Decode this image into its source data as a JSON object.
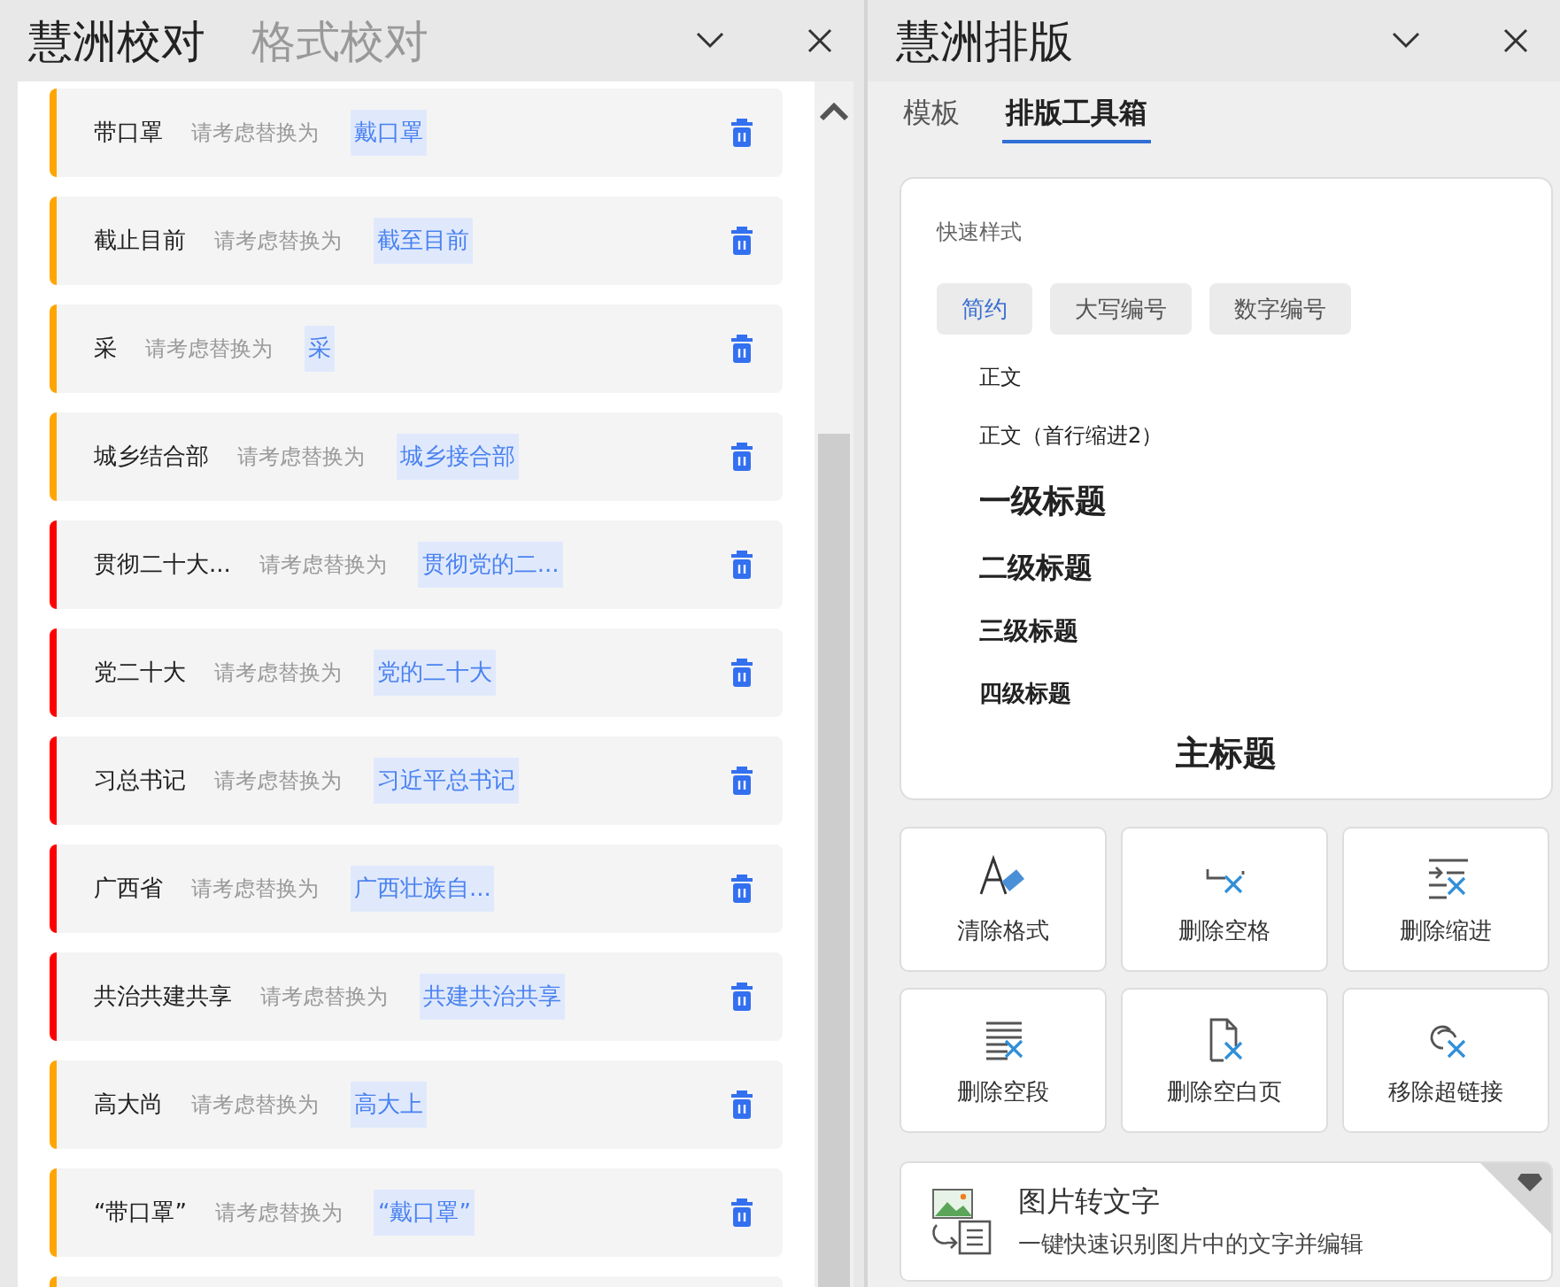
{
  "proofread_panel": {
    "tabs": [
      {
        "label": "慧洲校对",
        "selected": true
      },
      {
        "label": "格式校对",
        "selected": false
      }
    ],
    "items": [
      {
        "original": "带口罩",
        "hint": "请考虑替换为",
        "suggestion": "戴口罩",
        "color": "#ffa500"
      },
      {
        "original": "截止目前",
        "hint": "请考虑替换为",
        "suggestion": "截至目前",
        "color": "#ffa500"
      },
      {
        "original": "采",
        "hint": "请考虑替换为",
        "suggestion": "采",
        "color": "#ffa500"
      },
      {
        "original": "城乡结合部",
        "hint": "请考虑替换为",
        "suggestion": "城乡接合部",
        "color": "#ffa500"
      },
      {
        "original": "贯彻二十大...",
        "hint": "请考虑替换为",
        "suggestion": "贯彻党的二...",
        "color": "#ff0000"
      },
      {
        "original": "党二十大",
        "hint": "请考虑替换为",
        "suggestion": "党的二十大",
        "color": "#ff0000"
      },
      {
        "original": "习总书记",
        "hint": "请考虑替换为",
        "suggestion": "习近平总书记",
        "color": "#ff0000"
      },
      {
        "original": "广西省",
        "hint": "请考虑替换为",
        "suggestion": "广西壮族自...",
        "color": "#ff0000"
      },
      {
        "original": "共治共建共享",
        "hint": "请考虑替换为",
        "suggestion": "共建共治共享",
        "color": "#ff0000"
      },
      {
        "original": "高大尚",
        "hint": "请考虑替换为",
        "suggestion": "高大上",
        "color": "#ffa500"
      },
      {
        "original": "“带口罩”",
        "hint": "请考虑替换为",
        "suggestion": "“戴口罩”",
        "color": "#ffa500"
      },
      {
        "color": "#ffa500"
      }
    ]
  },
  "layout_panel": {
    "title": "慧洲排版",
    "tabs": [
      {
        "label": "模板",
        "selected": false
      },
      {
        "label": "排版工具箱",
        "selected": true
      }
    ],
    "quick_styles": {
      "heading": "快速样式",
      "presets": [
        {
          "label": "简约",
          "selected": true
        },
        {
          "label": "大写编号",
          "selected": false
        },
        {
          "label": "数字编号",
          "selected": false
        }
      ],
      "styles": [
        {
          "label": "正文",
          "kind": "body"
        },
        {
          "label": "正文（首行缩进2）",
          "kind": "body"
        },
        {
          "label": "一级标题",
          "kind": "h1"
        },
        {
          "label": "二级标题",
          "kind": "h2"
        },
        {
          "label": "三级标题",
          "kind": "h3"
        },
        {
          "label": "四级标题",
          "kind": "h4"
        },
        {
          "label": "主标题",
          "kind": "title"
        }
      ]
    },
    "tools": [
      {
        "label": "清除格式",
        "kind": "eraser"
      },
      {
        "label": "删除空格",
        "kind": "space"
      },
      {
        "label": "删除缩进",
        "kind": "indent"
      },
      {
        "label": "删除空段",
        "kind": "paragraph"
      },
      {
        "label": "删除空白页",
        "kind": "page"
      },
      {
        "label": "移除超链接",
        "kind": "link"
      }
    ],
    "feature": {
      "title": "图片转文字",
      "description": "一键快速识别图片中的文字并编辑",
      "premium": true
    }
  }
}
